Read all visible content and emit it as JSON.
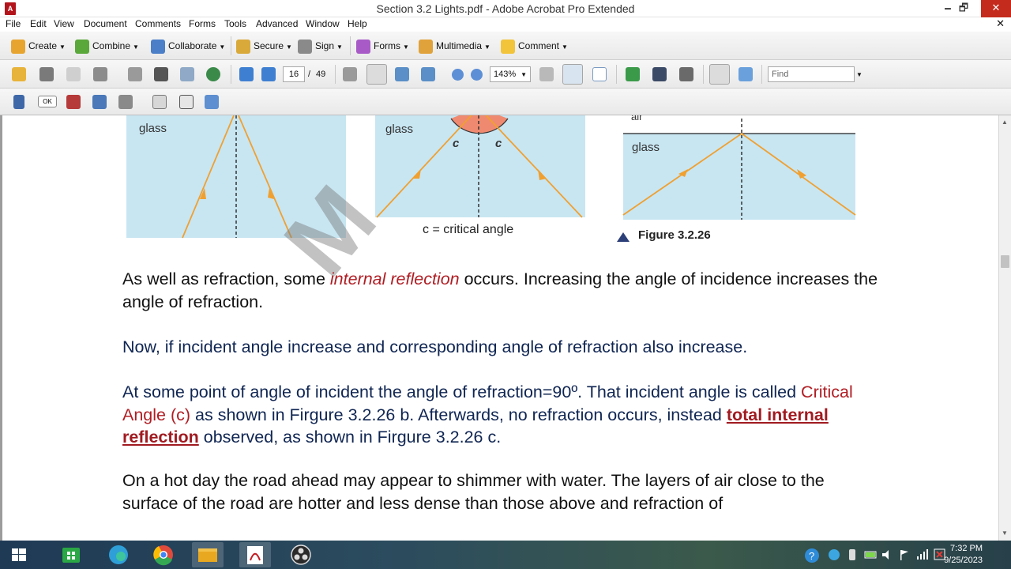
{
  "window": {
    "title": "Section 3.2 Lights.pdf - Adobe Acrobat Pro Extended",
    "minimize": "🗕",
    "restore": "🗗",
    "close": "✕"
  },
  "menu": [
    "File",
    "Edit",
    "View",
    "Document",
    "Comments",
    "Forms",
    "Tools",
    "Advanced",
    "Window",
    "Help"
  ],
  "menu_close": "✕",
  "toolbar1": [
    {
      "label": "Create",
      "icon": "create-icon",
      "color": "#e7a530"
    },
    {
      "label": "Combine",
      "icon": "combine-icon",
      "color": "#5aa83a"
    },
    {
      "label": "Collaborate",
      "icon": "collaborate-icon",
      "color": "#4b7fc8"
    },
    {
      "label": "Secure",
      "icon": "lock-icon",
      "color": "#d9a93a"
    },
    {
      "label": "Sign",
      "icon": "pen-icon",
      "color": "#6a6a6a"
    },
    {
      "label": "Forms",
      "icon": "forms-icon",
      "color": "#a85bc7"
    },
    {
      "label": "Multimedia",
      "icon": "multimedia-icon",
      "color": "#e0a23a"
    },
    {
      "label": "Comment",
      "icon": "comment-icon",
      "color": "#f2c43a"
    }
  ],
  "toolbar2": {
    "page_current": "16",
    "page_sep": "/",
    "page_total": "49",
    "zoom": "143%",
    "find_placeholder": "Find"
  },
  "figure": {
    "panel_a_label": "glass",
    "panel_b_label": "glass",
    "angle_left": "c",
    "angle_right": "c",
    "panel_b_caption": "c = critical angle",
    "panel_c_top": "air",
    "panel_c_label": "glass",
    "figure_caption": "Figure 3.2.26",
    "ray_color": "#f0a030",
    "panel_color": "#c8e6f2",
    "arc_color": "#ef8a70"
  },
  "paragraphs": {
    "p1_a": "As well as refraction, some ",
    "p1_em": "internal reflection",
    "p1_b": " occurs. Increasing the angle of incidence increases the angle of refraction.",
    "p2": "Now, if incident angle increase and corresponding angle of refraction also increase.",
    "p3_a": "At some point of angle of incident the angle of refraction=90º. That incident angle is called ",
    "p3_red": "Critical Angle (c)",
    "p3_b": " as shown in Firgure 3.2.26 b. Afterwards, no refraction occurs, instead ",
    "p3_bold": "total internal reflection",
    "p3_c": " observed, as shown in Firgure 3.2.26 c.",
    "p4": "On a hot day the road ahead may appear to shimmer with water. The layers of air close to the surface of the road are hotter and less dense than those above and refraction of"
  },
  "taskbar": {
    "clock_time": "7:32 PM",
    "clock_date": "9/25/2023",
    "apps": [
      "windows-start-icon",
      "store-icon",
      "edge-icon",
      "chrome-icon",
      "file-explorer-icon",
      "acrobat-icon",
      "obs-icon"
    ]
  },
  "colors": {
    "text_blue": "#0f2552",
    "text_red": "#b01d23"
  }
}
